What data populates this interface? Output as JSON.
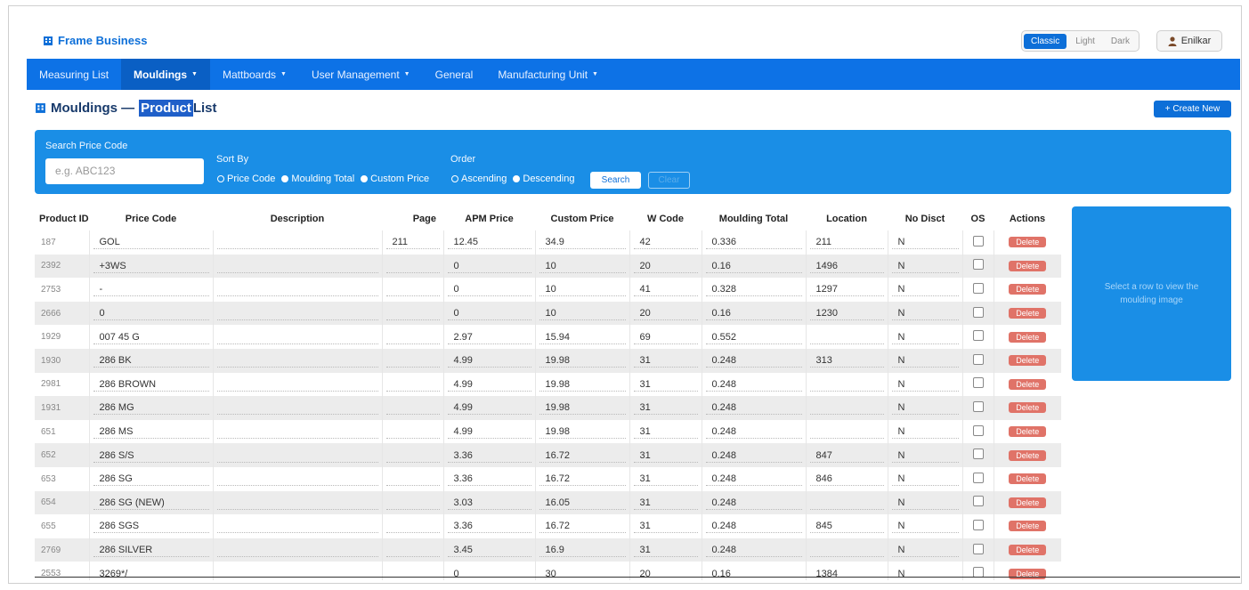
{
  "header": {
    "brand": "Frame Business",
    "themes": [
      "Classic",
      "Light",
      "Dark"
    ],
    "user": "Enilkar"
  },
  "nav": {
    "items": [
      {
        "label": "Measuring List"
      },
      {
        "label": "Mouldings"
      },
      {
        "label": "Mattboards"
      },
      {
        "label": "User Management"
      },
      {
        "label": "General"
      },
      {
        "label": "Manufacturing Unit"
      }
    ]
  },
  "page": {
    "title_prefix": "Mouldings —",
    "title_highlight": "Product",
    "title_suffix": "List",
    "create_label": "+ Create New"
  },
  "search": {
    "label": "Search Price Code",
    "placeholder": "e.g. ABC123",
    "sort_label": "Sort By",
    "sort_options": [
      "Price Code",
      "Moulding Total",
      "Custom Price"
    ],
    "order_label": "Order",
    "order_options": [
      "Ascending",
      "Descending"
    ],
    "search_label": "Search",
    "clear_label": "Clear"
  },
  "table": {
    "headers": [
      "Product ID",
      "Price Code",
      "Description",
      "Page",
      "APM Price",
      "Custom Price",
      "W Code",
      "Moulding Total",
      "Location",
      "No Disct",
      "OS",
      "Actions"
    ],
    "delete_label": "Delete",
    "rows": [
      [
        "187",
        "GOL",
        "",
        "211",
        "12.45",
        "34.9",
        "42",
        "0.336",
        "211",
        "N"
      ],
      [
        "2392",
        "+3WS",
        "",
        "",
        "0",
        "10",
        "20",
        "0.16",
        "1496",
        "N"
      ],
      [
        "2753",
        "-",
        "",
        "",
        "0",
        "10",
        "41",
        "0.328",
        "1297",
        "N"
      ],
      [
        "2666",
        "0",
        "",
        "",
        "0",
        "10",
        "20",
        "0.16",
        "1230",
        "N"
      ],
      [
        "1929",
        "007 45 G",
        "",
        "",
        "2.97",
        "15.94",
        "69",
        "0.552",
        "",
        "N"
      ],
      [
        "1930",
        "286 BK",
        "",
        "",
        "4.99",
        "19.98",
        "31",
        "0.248",
        "313",
        "N"
      ],
      [
        "2981",
        "286 BROWN",
        "",
        "",
        "4.99",
        "19.98",
        "31",
        "0.248",
        "",
        "N"
      ],
      [
        "1931",
        "286 MG",
        "",
        "",
        "4.99",
        "19.98",
        "31",
        "0.248",
        "",
        "N"
      ],
      [
        "651",
        "286 MS",
        "",
        "",
        "4.99",
        "19.98",
        "31",
        "0.248",
        "",
        "N"
      ],
      [
        "652",
        "286 S/S",
        "",
        "",
        "3.36",
        "16.72",
        "31",
        "0.248",
        "847",
        "N"
      ],
      [
        "653",
        "286 SG",
        "",
        "",
        "3.36",
        "16.72",
        "31",
        "0.248",
        "846",
        "N"
      ],
      [
        "654",
        "286 SG (NEW)",
        "",
        "",
        "3.03",
        "16.05",
        "31",
        "0.248",
        "",
        "N"
      ],
      [
        "655",
        "286 SGS",
        "",
        "",
        "3.36",
        "16.72",
        "31",
        "0.248",
        "845",
        "N"
      ],
      [
        "2769",
        "286 SILVER",
        "",
        "",
        "3.45",
        "16.9",
        "31",
        "0.248",
        "",
        "N"
      ],
      [
        "2553",
        "3269*/",
        "",
        "",
        "0",
        "30",
        "20",
        "0.16",
        "1384",
        "N"
      ]
    ]
  },
  "preview": {
    "text": "Select a row to view the moulding image"
  }
}
